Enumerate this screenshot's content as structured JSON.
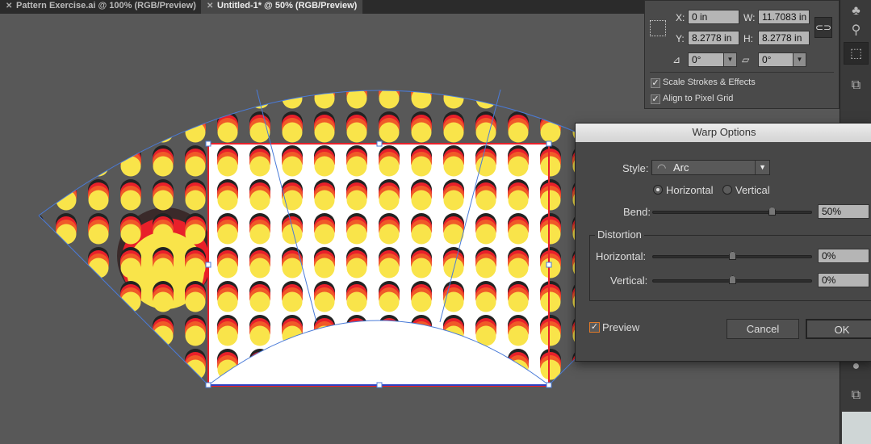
{
  "tabs": [
    {
      "label": "Pattern Exercise.ai @ 100% (RGB/Preview)",
      "active": false
    },
    {
      "label": "Untitled-1* @ 50% (RGB/Preview)",
      "active": true
    }
  ],
  "transform_panel": {
    "x_label": "X:",
    "x_value": "0 in",
    "y_label": "Y:",
    "y_value": "8.2778 in",
    "w_label": "W:",
    "w_value": "11.7083 in",
    "h_label": "H:",
    "h_value": "8.2778 in",
    "rotate_value": "0°",
    "shear_value": "0°",
    "scale_strokes_label": "Scale Strokes & Effects",
    "scale_strokes_checked": true,
    "align_pixel_label": "Align to Pixel Grid",
    "align_pixel_checked": true
  },
  "warp_dialog": {
    "title": "Warp Options",
    "style_label": "Style:",
    "style_value": "Arc",
    "horizontal_label": "Horizontal",
    "vertical_label": "Vertical",
    "orientation": "Horizontal",
    "bend_label": "Bend:",
    "bend_value": "50%",
    "bend": 50,
    "distortion_label": "Distortion",
    "dist_horizontal_label": "Horizontal:",
    "dist_horizontal_value": "0%",
    "dist_vertical_label": "Vertical:",
    "dist_vertical_value": "0%",
    "preview_label": "Preview",
    "preview_checked": true,
    "cancel_label": "Cancel",
    "ok_label": "OK"
  },
  "colors": {
    "dot_yellow": "#f9e44a",
    "dot_red": "#e8202a",
    "dot_orange": "#f05a28",
    "dot_black": "#222222",
    "selection": "#4a7bd8",
    "accent_check": "#e07a2a"
  }
}
